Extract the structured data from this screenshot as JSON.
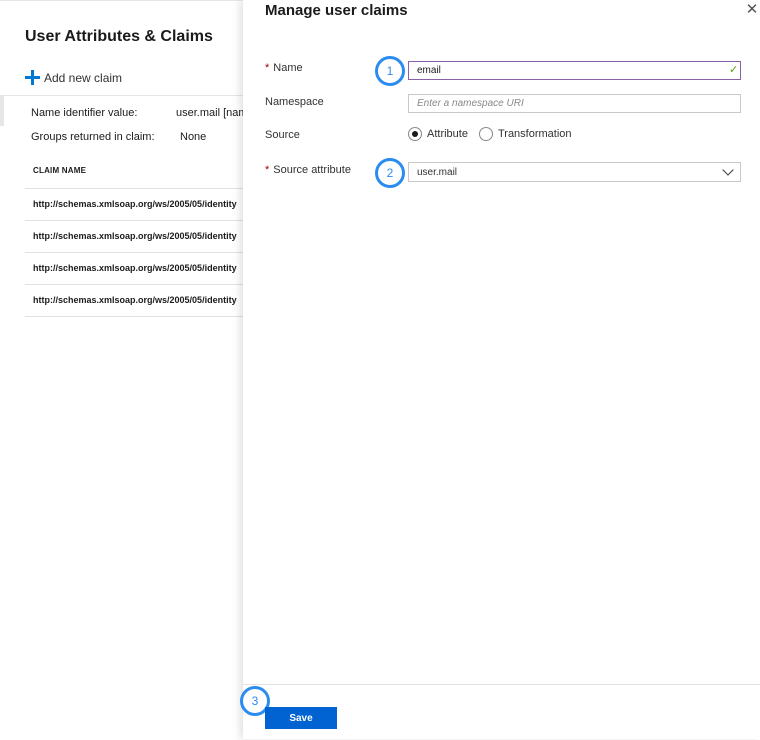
{
  "background_blade": {
    "title": "User Attributes & Claims",
    "add_claim_label": "Add new claim",
    "name_identifier_label": "Name identifier value:",
    "name_identifier_value": "user.mail [nam",
    "groups_label": "Groups returned in claim:",
    "groups_value": "None",
    "claim_name_header": "CLAIM NAME",
    "claims": [
      "http://schemas.xmlsoap.org/ws/2005/05/identity",
      "http://schemas.xmlsoap.org/ws/2005/05/identity",
      "http://schemas.xmlsoap.org/ws/2005/05/identity",
      "http://schemas.xmlsoap.org/ws/2005/05/identity"
    ]
  },
  "panel": {
    "title": "Manage user claims",
    "close_glyph": "✕",
    "required_marker": "*",
    "name_label": "Name",
    "name_value": "email",
    "name_valid_glyph": "✓",
    "namespace_label": "Namespace",
    "namespace_placeholder": "Enter a namespace URI",
    "source_label": "Source",
    "source_options": [
      "Attribute",
      "Transformation"
    ],
    "source_selected": "Attribute",
    "source_attribute_label": "Source attribute",
    "source_attribute_value": "user.mail",
    "save_label": "Save"
  },
  "step_badges": [
    "1",
    "2",
    "3"
  ],
  "colors": {
    "accent": "#0063d1",
    "badge": "#2b8cf0",
    "required": "#a80000",
    "valid": "#57a300",
    "active_input_border": "#8a61a6"
  }
}
